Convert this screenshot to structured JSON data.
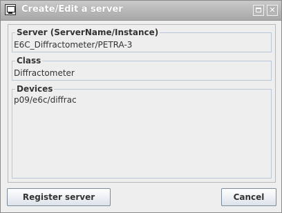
{
  "window": {
    "title": "Create/Edit a server"
  },
  "form": {
    "server_label": "Server (ServerName/Instance)",
    "server_value": "E6C_Diffractometer/PETRA-3",
    "class_label": "Class",
    "class_value": "Diffractometer",
    "devices_label": "Devices",
    "devices_value": "p09/e6c/diffrac"
  },
  "buttons": {
    "register": "Register server",
    "cancel": "Cancel"
  },
  "icons": {
    "app": "computer-monitor-icon",
    "maximize": "maximize-icon",
    "close": "close-icon"
  }
}
